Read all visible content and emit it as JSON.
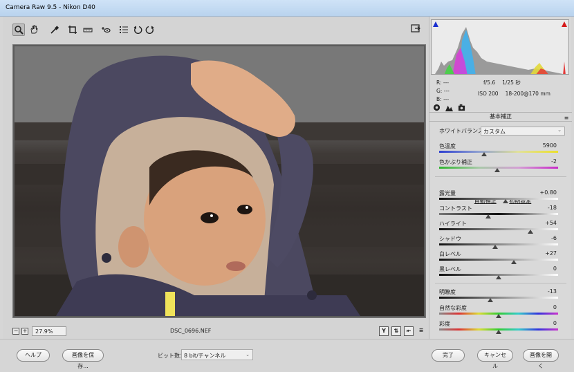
{
  "window": {
    "title": "Camera Raw 9.5  -  Nikon D40"
  },
  "toolbar": {
    "tools": [
      "zoom-icon",
      "hand-icon",
      "white-balance-icon",
      "crop-icon",
      "straighten-icon",
      "spot-removal-icon",
      "presets-list-icon",
      "rotate-left-icon",
      "rotate-right-icon"
    ],
    "right_tool": "toggle-fullscreen-icon"
  },
  "preview": {
    "zoom": "27.9%",
    "filename": "DSC_0696.NEF",
    "view_buttons": [
      "Y",
      "⇅",
      "⇤",
      "≡"
    ]
  },
  "readout": {
    "r_label": "R:",
    "r_value": "---",
    "g_label": "G:",
    "g_value": "---",
    "b_label": "B:",
    "b_value": "---",
    "aperture": "f/5.6",
    "shutter": "1/25 秒",
    "iso": "ISO 200",
    "lens": "18-200@170 mm"
  },
  "panel": {
    "title": "基本補正",
    "wb_label": "ホワイトバランス：",
    "wb_value": "カスタム",
    "auto_label": "自動補正",
    "default_label": "初期設定"
  },
  "sliders": {
    "temp": {
      "label": "色温度",
      "value": "5900",
      "pos": 0.38
    },
    "tint": {
      "label": "色かぶり補正",
      "value": "-2",
      "pos": 0.49
    },
    "exposure": {
      "label": "露光量",
      "value": "+0.80",
      "pos": 0.56
    },
    "contrast": {
      "label": "コントラスト",
      "value": "-18",
      "pos": 0.41
    },
    "highlights": {
      "label": "ハイライト",
      "value": "+54",
      "pos": 0.77
    },
    "shadows": {
      "label": "シャドウ",
      "value": "-6",
      "pos": 0.47
    },
    "whites": {
      "label": "白レベル",
      "value": "+27",
      "pos": 0.63
    },
    "blacks": {
      "label": "黒レベル",
      "value": "0",
      "pos": 0.5
    },
    "clarity": {
      "label": "明瞭度",
      "value": "-13",
      "pos": 0.43
    },
    "vibrance": {
      "label": "自然な彩度",
      "value": "0",
      "pos": 0.5
    },
    "saturation": {
      "label": "彩度",
      "value": "0",
      "pos": 0.5
    }
  },
  "bottom": {
    "help": "ヘルプ",
    "save": "画像を保存...",
    "bit_label": "ビット数：",
    "bit_value": "8 bit/チャンネル",
    "done": "完了",
    "cancel": "キャンセル",
    "open": "画像を開く"
  }
}
